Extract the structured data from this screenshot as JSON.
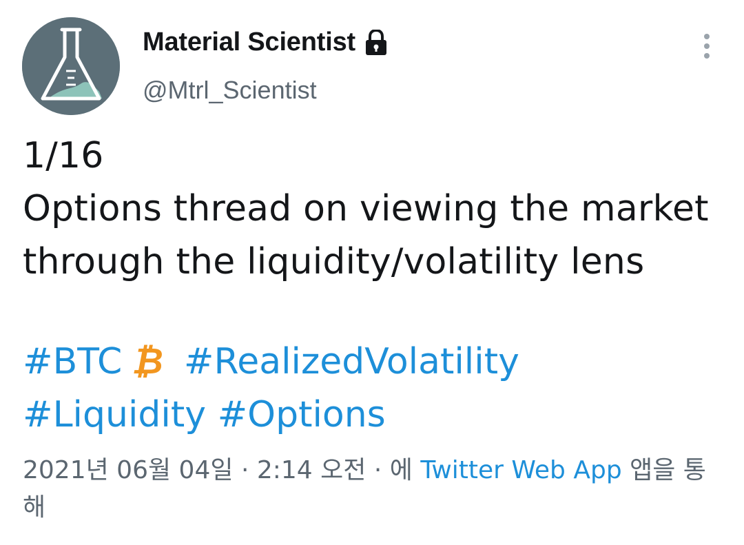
{
  "user": {
    "display_name": "Material Scientist",
    "handle": "@Mtrl_Scientist",
    "avatar_icon": "flask-icon",
    "verified_lock_icon": "lock-icon"
  },
  "tweet": {
    "text": "1/16\nOptions thread on viewing the market through the liquidity/volatility lens",
    "hashtags": [
      "#BTC",
      "#RealizedVolatility",
      "#Liquidity",
      "#Options"
    ],
    "btc_symbol": "₿"
  },
  "meta": {
    "date": "2021년 06월 04일",
    "separator": "·",
    "time": "2:14 오전",
    "via_prefix": "에",
    "app": "Twitter Web App",
    "via_suffix": "앱을 통해"
  },
  "colors": {
    "link": "#1d8fd9",
    "text": "#141619",
    "secondary": "#5b6670",
    "bitcoin": "#f2961f",
    "avatar_bg": "#5c6f78"
  }
}
